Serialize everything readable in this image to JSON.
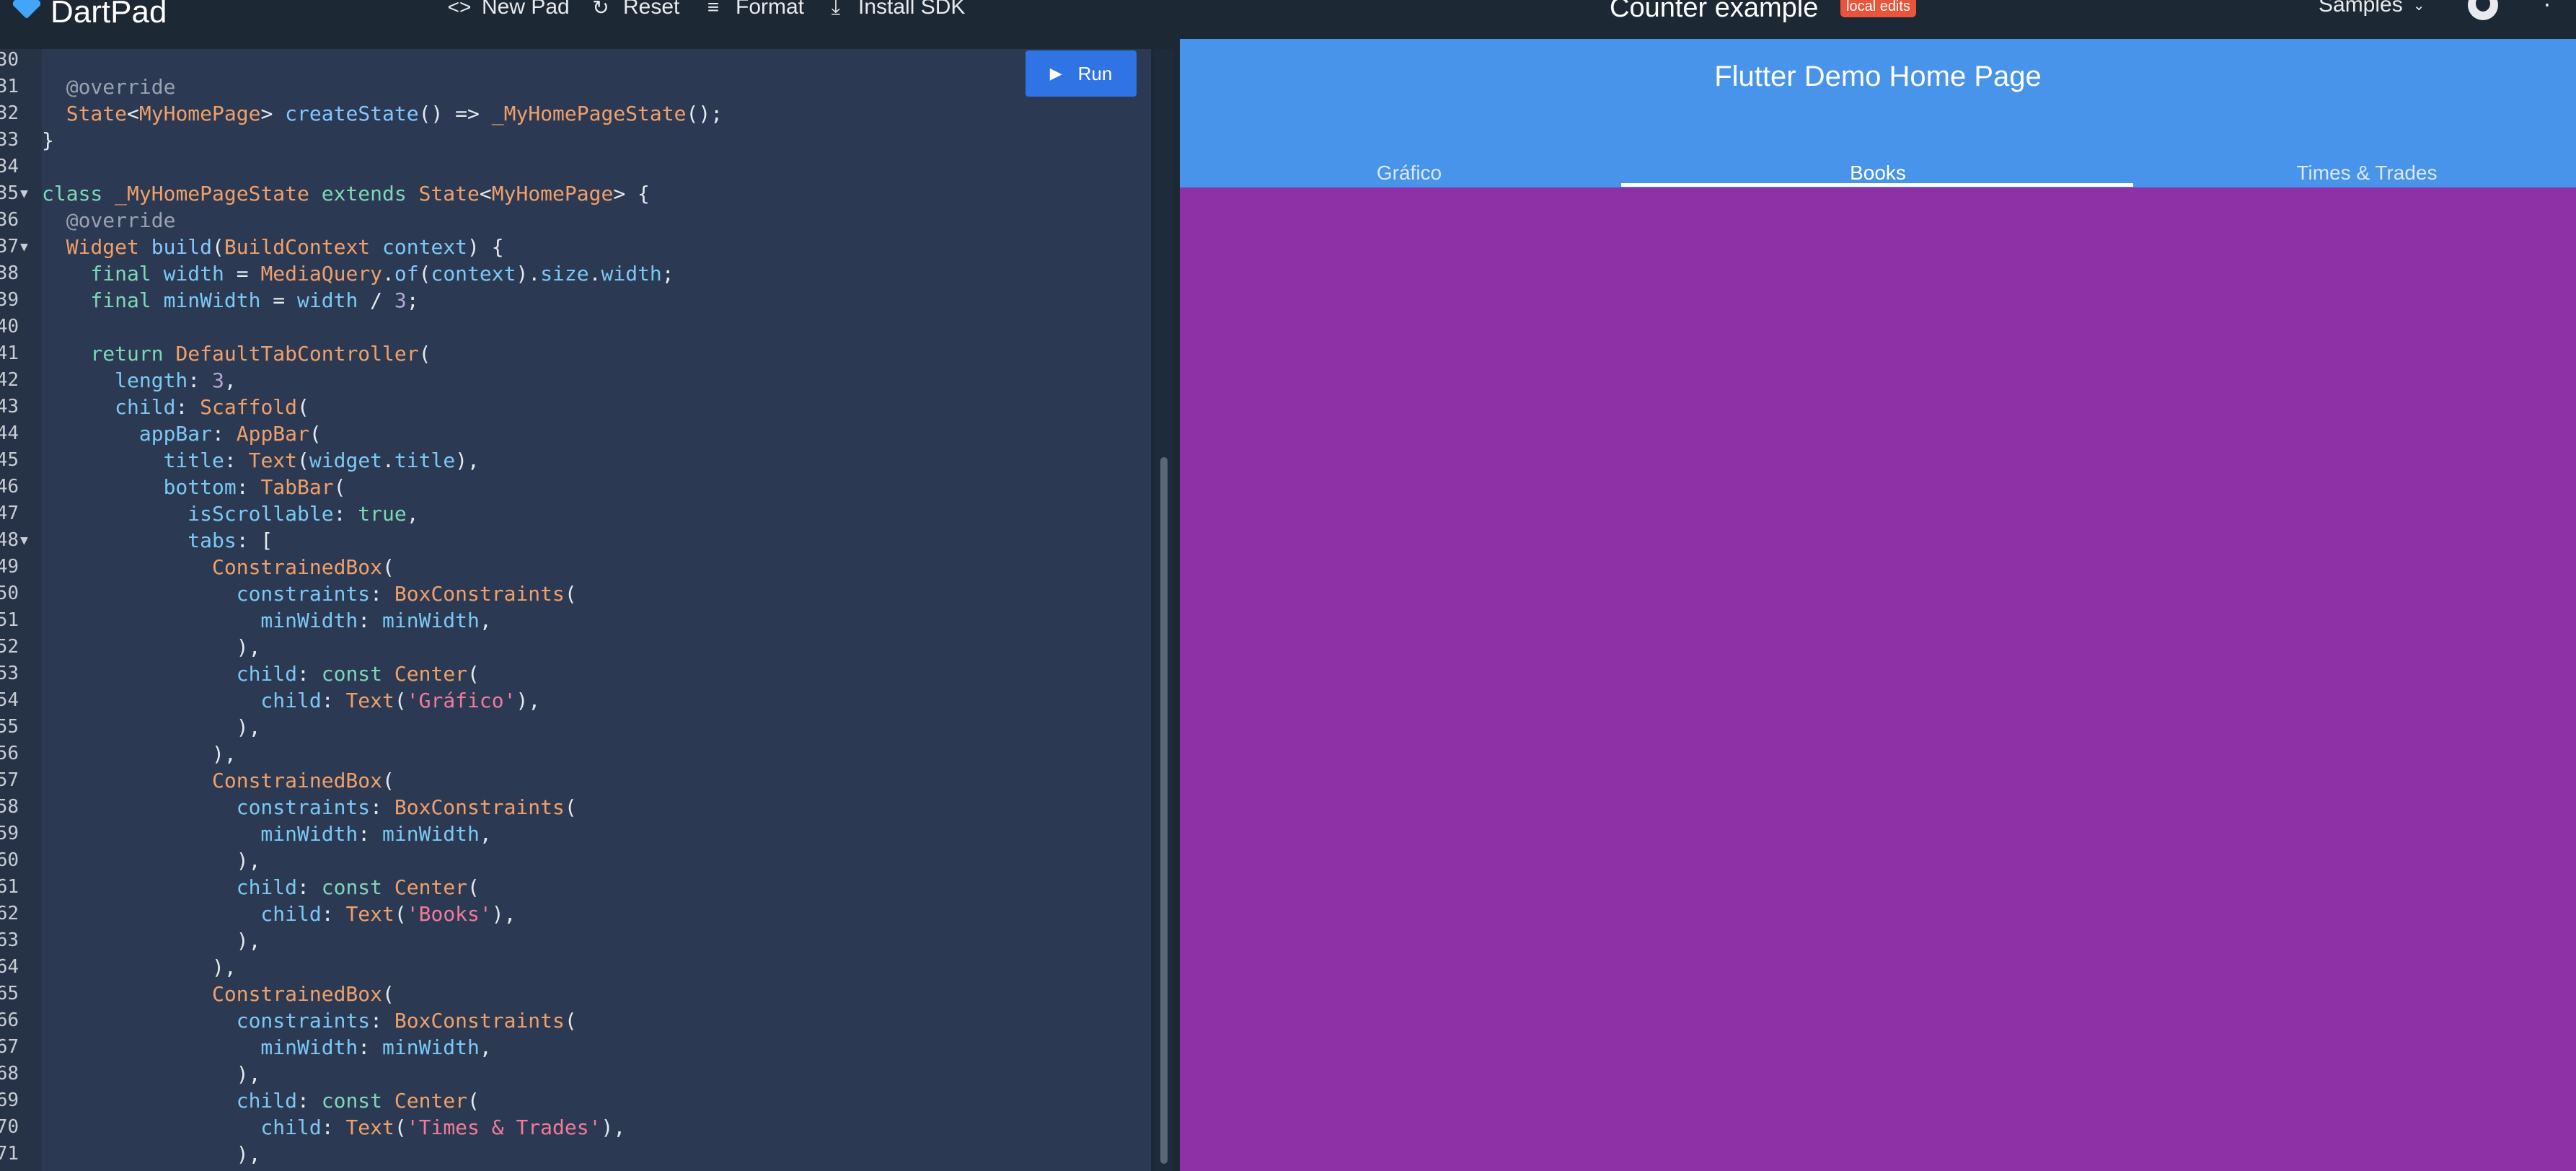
{
  "topbar": {
    "brand": "DartPad",
    "new_pad": "New Pad",
    "reset": "Reset",
    "format": "Format",
    "install_sdk": "Install SDK",
    "title": "Counter example",
    "badge": "local edits",
    "samples": "Samples"
  },
  "editor": {
    "run_label": "Run",
    "lines": [
      {
        "n": "30",
        "fold": false
      },
      {
        "n": "31",
        "fold": false
      },
      {
        "n": "32",
        "fold": false
      },
      {
        "n": "33",
        "fold": false
      },
      {
        "n": "34",
        "fold": false
      },
      {
        "n": "35",
        "fold": true
      },
      {
        "n": "36",
        "fold": false
      },
      {
        "n": "37",
        "fold": true
      },
      {
        "n": "38",
        "fold": false
      },
      {
        "n": "39",
        "fold": false
      },
      {
        "n": "40",
        "fold": false
      },
      {
        "n": "41",
        "fold": false
      },
      {
        "n": "42",
        "fold": false
      },
      {
        "n": "43",
        "fold": false
      },
      {
        "n": "44",
        "fold": false
      },
      {
        "n": "45",
        "fold": false
      },
      {
        "n": "46",
        "fold": false
      },
      {
        "n": "47",
        "fold": false
      },
      {
        "n": "48",
        "fold": true
      },
      {
        "n": "49",
        "fold": false
      },
      {
        "n": "50",
        "fold": false
      },
      {
        "n": "51",
        "fold": false
      },
      {
        "n": "52",
        "fold": false
      },
      {
        "n": "53",
        "fold": false
      },
      {
        "n": "54",
        "fold": false
      },
      {
        "n": "55",
        "fold": false
      },
      {
        "n": "56",
        "fold": false
      },
      {
        "n": "57",
        "fold": false
      },
      {
        "n": "58",
        "fold": false
      },
      {
        "n": "59",
        "fold": false
      },
      {
        "n": "60",
        "fold": false
      },
      {
        "n": "61",
        "fold": false
      },
      {
        "n": "62",
        "fold": false
      },
      {
        "n": "63",
        "fold": false
      },
      {
        "n": "64",
        "fold": false
      },
      {
        "n": "65",
        "fold": false
      },
      {
        "n": "66",
        "fold": false
      },
      {
        "n": "67",
        "fold": false
      },
      {
        "n": "68",
        "fold": false
      },
      {
        "n": "69",
        "fold": false
      },
      {
        "n": "70",
        "fold": false
      },
      {
        "n": "71",
        "fold": false
      }
    ],
    "code": [
      [],
      [
        [
          "ann",
          "  @override"
        ]
      ],
      [
        [
          "type",
          "  State"
        ],
        [
          "plain",
          "<"
        ],
        [
          "type",
          "MyHomePage"
        ],
        [
          "plain",
          "> "
        ],
        [
          "fn",
          "createState"
        ],
        [
          "plain",
          "() => "
        ],
        [
          "type",
          "_MyHomePageState"
        ],
        [
          "plain",
          "();"
        ]
      ],
      [
        [
          "plain",
          "}"
        ]
      ],
      [],
      [
        [
          "kw",
          "class "
        ],
        [
          "type",
          "_MyHomePageState "
        ],
        [
          "kw",
          "extends "
        ],
        [
          "type",
          "State"
        ],
        [
          "plain",
          "<"
        ],
        [
          "type",
          "MyHomePage"
        ],
        [
          "plain",
          "> {"
        ]
      ],
      [
        [
          "ann",
          "  @override"
        ]
      ],
      [
        [
          "type",
          "  Widget "
        ],
        [
          "fn",
          "build"
        ],
        [
          "plain",
          "("
        ],
        [
          "type",
          "BuildContext "
        ],
        [
          "prop",
          "context"
        ],
        [
          "plain",
          ") {"
        ]
      ],
      [
        [
          "kw",
          "    final "
        ],
        [
          "prop",
          "width"
        ],
        [
          "plain",
          " = "
        ],
        [
          "type",
          "MediaQuery"
        ],
        [
          "plain",
          "."
        ],
        [
          "fn",
          "of"
        ],
        [
          "plain",
          "("
        ],
        [
          "prop",
          "context"
        ],
        [
          "plain",
          ")."
        ],
        [
          "prop",
          "size"
        ],
        [
          "plain",
          "."
        ],
        [
          "prop",
          "width"
        ],
        [
          "plain",
          ";"
        ]
      ],
      [
        [
          "kw",
          "    final "
        ],
        [
          "prop",
          "minWidth"
        ],
        [
          "plain",
          " = "
        ],
        [
          "prop",
          "width"
        ],
        [
          "plain",
          " / "
        ],
        [
          "num",
          "3"
        ],
        [
          "plain",
          ";"
        ]
      ],
      [],
      [
        [
          "kw",
          "    return "
        ],
        [
          "type",
          "DefaultTabController"
        ],
        [
          "plain",
          "("
        ]
      ],
      [
        [
          "prop",
          "      length"
        ],
        [
          "plain",
          ": "
        ],
        [
          "num",
          "3"
        ],
        [
          "plain",
          ","
        ]
      ],
      [
        [
          "prop",
          "      child"
        ],
        [
          "plain",
          ": "
        ],
        [
          "type",
          "Scaffold"
        ],
        [
          "plain",
          "("
        ]
      ],
      [
        [
          "prop",
          "        appBar"
        ],
        [
          "plain",
          ": "
        ],
        [
          "type",
          "AppBar"
        ],
        [
          "plain",
          "("
        ]
      ],
      [
        [
          "prop",
          "          title"
        ],
        [
          "plain",
          ": "
        ],
        [
          "type",
          "Text"
        ],
        [
          "plain",
          "("
        ],
        [
          "prop",
          "widget"
        ],
        [
          "plain",
          "."
        ],
        [
          "prop",
          "title"
        ],
        [
          "plain",
          "),"
        ]
      ],
      [
        [
          "prop",
          "          bottom"
        ],
        [
          "plain",
          ": "
        ],
        [
          "type",
          "TabBar"
        ],
        [
          "plain",
          "("
        ]
      ],
      [
        [
          "prop",
          "            isScrollable"
        ],
        [
          "plain",
          ": "
        ],
        [
          "kw",
          "true"
        ],
        [
          "plain",
          ","
        ]
      ],
      [
        [
          "prop",
          "            tabs"
        ],
        [
          "plain",
          ": ["
        ]
      ],
      [
        [
          "type",
          "              ConstrainedBox"
        ],
        [
          "plain",
          "("
        ]
      ],
      [
        [
          "prop",
          "                constraints"
        ],
        [
          "plain",
          ": "
        ],
        [
          "type",
          "BoxConstraints"
        ],
        [
          "plain",
          "("
        ]
      ],
      [
        [
          "prop",
          "                  minWidth"
        ],
        [
          "plain",
          ": "
        ],
        [
          "prop",
          "minWidth"
        ],
        [
          "plain",
          ","
        ]
      ],
      [
        [
          "plain",
          "                ),"
        ]
      ],
      [
        [
          "prop",
          "                child"
        ],
        [
          "plain",
          ": "
        ],
        [
          "kw",
          "const "
        ],
        [
          "type",
          "Center"
        ],
        [
          "plain",
          "("
        ]
      ],
      [
        [
          "prop",
          "                  child"
        ],
        [
          "plain",
          ": "
        ],
        [
          "type",
          "Text"
        ],
        [
          "plain",
          "("
        ],
        [
          "str",
          "'Gráfico'"
        ],
        [
          "plain",
          "),"
        ]
      ],
      [
        [
          "plain",
          "                ),"
        ]
      ],
      [
        [
          "plain",
          "              ),"
        ]
      ],
      [
        [
          "type",
          "              ConstrainedBox"
        ],
        [
          "plain",
          "("
        ]
      ],
      [
        [
          "prop",
          "                constraints"
        ],
        [
          "plain",
          ": "
        ],
        [
          "type",
          "BoxConstraints"
        ],
        [
          "plain",
          "("
        ]
      ],
      [
        [
          "prop",
          "                  minWidth"
        ],
        [
          "plain",
          ": "
        ],
        [
          "prop",
          "minWidth"
        ],
        [
          "plain",
          ","
        ]
      ],
      [
        [
          "plain",
          "                ),"
        ]
      ],
      [
        [
          "prop",
          "                child"
        ],
        [
          "plain",
          ": "
        ],
        [
          "kw",
          "const "
        ],
        [
          "type",
          "Center"
        ],
        [
          "plain",
          "("
        ]
      ],
      [
        [
          "prop",
          "                  child"
        ],
        [
          "plain",
          ": "
        ],
        [
          "type",
          "Text"
        ],
        [
          "plain",
          "("
        ],
        [
          "str",
          "'Books'"
        ],
        [
          "plain",
          "),"
        ]
      ],
      [
        [
          "plain",
          "                ),"
        ]
      ],
      [
        [
          "plain",
          "              ),"
        ]
      ],
      [
        [
          "type",
          "              ConstrainedBox"
        ],
        [
          "plain",
          "("
        ]
      ],
      [
        [
          "prop",
          "                constraints"
        ],
        [
          "plain",
          ": "
        ],
        [
          "type",
          "BoxConstraints"
        ],
        [
          "plain",
          "("
        ]
      ],
      [
        [
          "prop",
          "                  minWidth"
        ],
        [
          "plain",
          ": "
        ],
        [
          "prop",
          "minWidth"
        ],
        [
          "plain",
          ","
        ]
      ],
      [
        [
          "plain",
          "                ),"
        ]
      ],
      [
        [
          "prop",
          "                child"
        ],
        [
          "plain",
          ": "
        ],
        [
          "kw",
          "const "
        ],
        [
          "type",
          "Center"
        ],
        [
          "plain",
          "("
        ]
      ],
      [
        [
          "prop",
          "                  child"
        ],
        [
          "plain",
          ": "
        ],
        [
          "type",
          "Text"
        ],
        [
          "plain",
          "("
        ],
        [
          "str",
          "'Times & Trades'"
        ],
        [
          "plain",
          "),"
        ]
      ],
      [
        [
          "plain",
          "                ),"
        ]
      ]
    ]
  },
  "preview": {
    "title": "Flutter Demo Home Page",
    "tabs": [
      "Gráfico",
      "Books",
      "Times & Trades"
    ],
    "active_tab": "Books",
    "colors": {
      "appbar": "#4894ea",
      "body": "#8e31a6"
    }
  }
}
